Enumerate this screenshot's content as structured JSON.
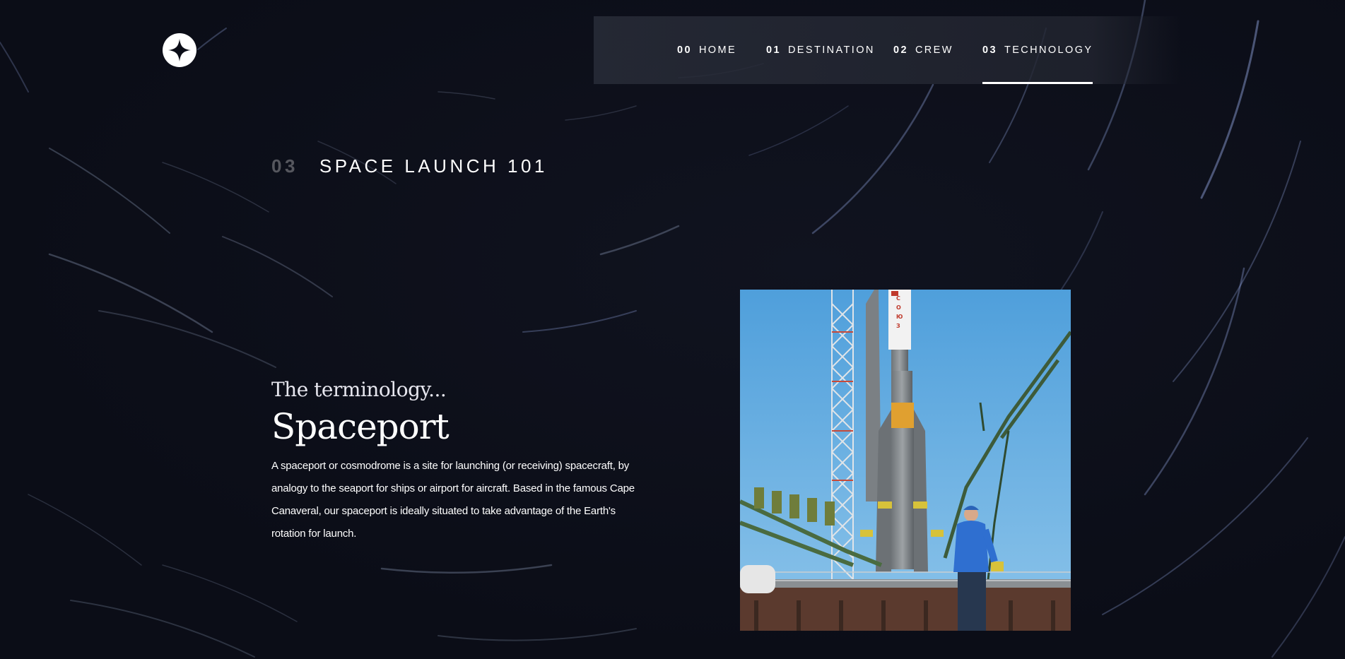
{
  "nav": {
    "items": [
      {
        "num": "00",
        "label": "HOME"
      },
      {
        "num": "01",
        "label": "DESTINATION"
      },
      {
        "num": "02",
        "label": "CREW"
      },
      {
        "num": "03",
        "label": "TECHNOLOGY"
      }
    ],
    "active_index": 3
  },
  "logo": {
    "icon": "star-logo-icon"
  },
  "heading": {
    "num": "03",
    "title": "SPACE LAUNCH 101"
  },
  "technology": {
    "kicker": "The terminology...",
    "name": "Spaceport",
    "description": "A spaceport or cosmodrome is a site for launching (or receiving) spacecraft, by analogy to the seaport for ships or airport for aircraft. Based in the famous Cape Canaveral, our spaceport is ideally situated to take advantage of the Earth's rotation for launch.",
    "image_alt": "Spaceport launch image"
  },
  "colors": {
    "background": "#0b0d17",
    "text": "#ffffff",
    "nav_bg": "#282c38",
    "sky": "#5aa9df"
  }
}
